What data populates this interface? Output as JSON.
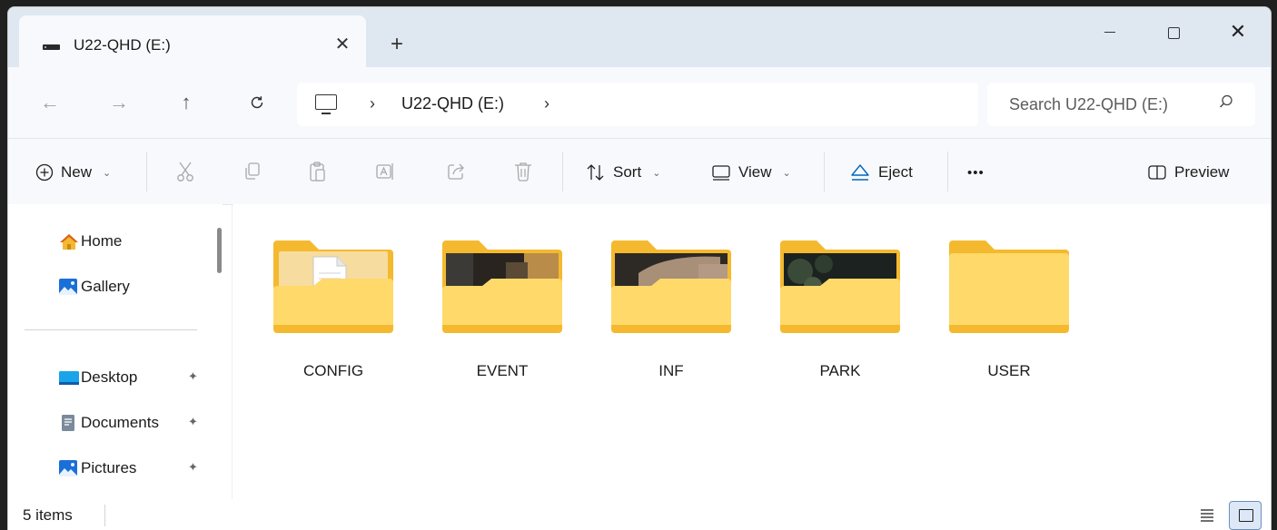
{
  "window": {
    "tab_title": "U22-QHD (E:)",
    "close_tab": "✕",
    "new_tab": "+",
    "minimize": "—",
    "maximize": "☐",
    "close": "✕"
  },
  "address": {
    "back": "←",
    "forward": "→",
    "up": "↑",
    "refresh": "C",
    "chevron": "›",
    "segment": "U22-QHD (E:)",
    "search_placeholder": "Search U22-QHD (E:)"
  },
  "toolbar": {
    "new_label": "New",
    "sort_label": "Sort",
    "view_label": "View",
    "eject_label": "Eject",
    "more_label": "•••",
    "preview_label": "Preview",
    "caret": "⌄"
  },
  "sidebar": {
    "items": [
      {
        "label": "Home",
        "icon": "home-icon"
      },
      {
        "label": "Gallery",
        "icon": "gallery-icon"
      },
      {
        "label": "Desktop",
        "icon": "desktop-icon",
        "pinned": true
      },
      {
        "label": "Documents",
        "icon": "documents-icon",
        "pinned": true
      },
      {
        "label": "Pictures",
        "icon": "pictures-icon",
        "pinned": true
      }
    ],
    "pin_glyph": "✦"
  },
  "folders": [
    {
      "name": "CONFIG",
      "thumb": "document"
    },
    {
      "name": "EVENT",
      "thumb": "photo"
    },
    {
      "name": "INF",
      "thumb": "photo"
    },
    {
      "name": "PARK",
      "thumb": "photo"
    },
    {
      "name": "USER",
      "thumb": "none"
    }
  ],
  "status": {
    "item_count": "5 items"
  },
  "colors": {
    "folder_back": "#f4b92e",
    "folder_front": "#ffd96a",
    "accent": "#0067c0",
    "titlebar": "#dfe7f1"
  }
}
